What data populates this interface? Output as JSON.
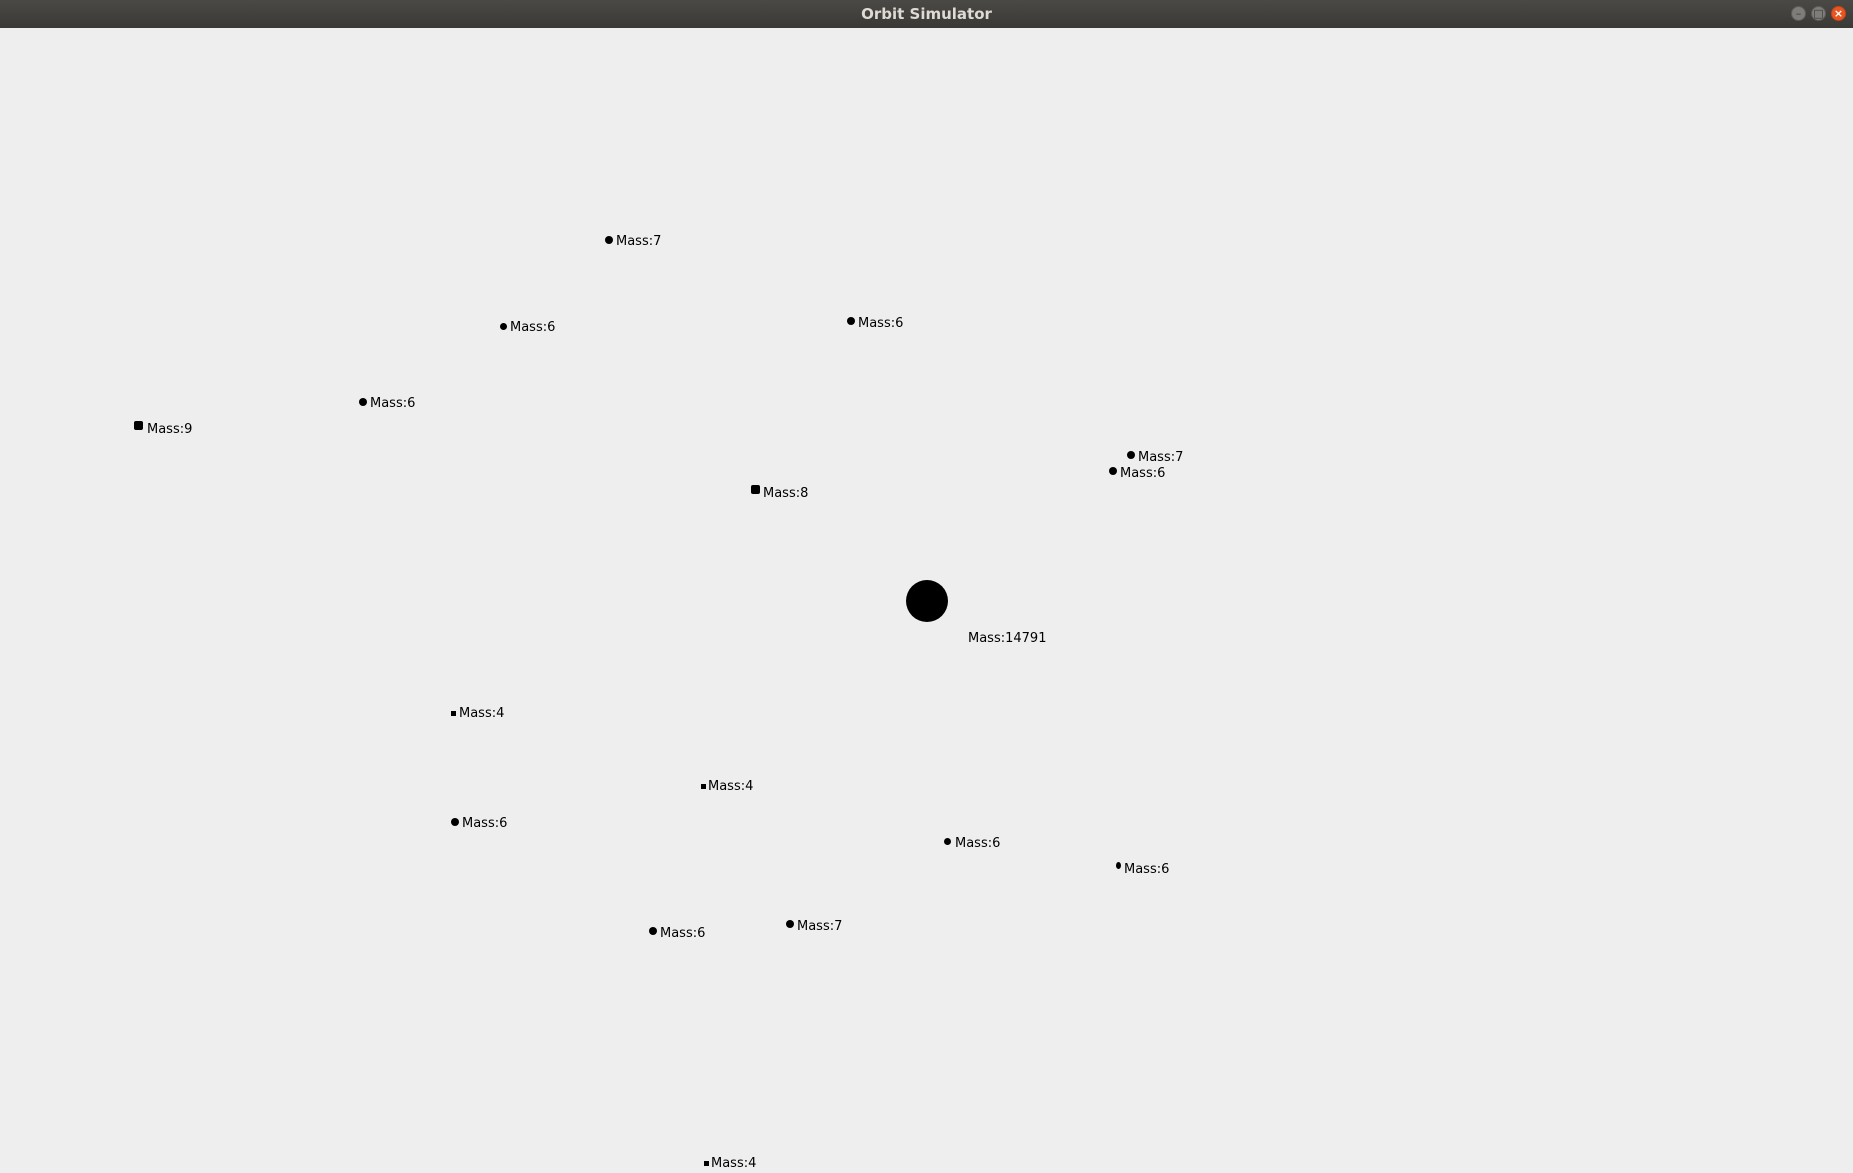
{
  "window": {
    "title": "Orbit Simulator",
    "controls": {
      "minimize": "–",
      "maximize": "□",
      "close": "×"
    }
  },
  "simulation": {
    "central_body": {
      "label": "Mass:14791",
      "mass": 14791
    },
    "bodies": [
      {
        "label": "Mass:7",
        "mass": 7
      },
      {
        "label": "Mass:6",
        "mass": 6
      },
      {
        "label": "Mass:6",
        "mass": 6
      },
      {
        "label": "Mass:6",
        "mass": 6
      },
      {
        "label": "Mass:9",
        "mass": 9
      },
      {
        "label": "Mass:7",
        "mass": 7
      },
      {
        "label": "Mass:6",
        "mass": 6
      },
      {
        "label": "Mass:8",
        "mass": 8
      },
      {
        "label": "Mass:4",
        "mass": 4
      },
      {
        "label": "Mass:4",
        "mass": 4
      },
      {
        "label": "Mass:6",
        "mass": 6
      },
      {
        "label": "Mass:6",
        "mass": 6
      },
      {
        "label": "Mass:6",
        "mass": 6
      },
      {
        "label": "Mass:6",
        "mass": 6
      },
      {
        "label": "Mass:7",
        "mass": 7
      },
      {
        "label": "Mass:4",
        "mass": 4
      }
    ]
  }
}
